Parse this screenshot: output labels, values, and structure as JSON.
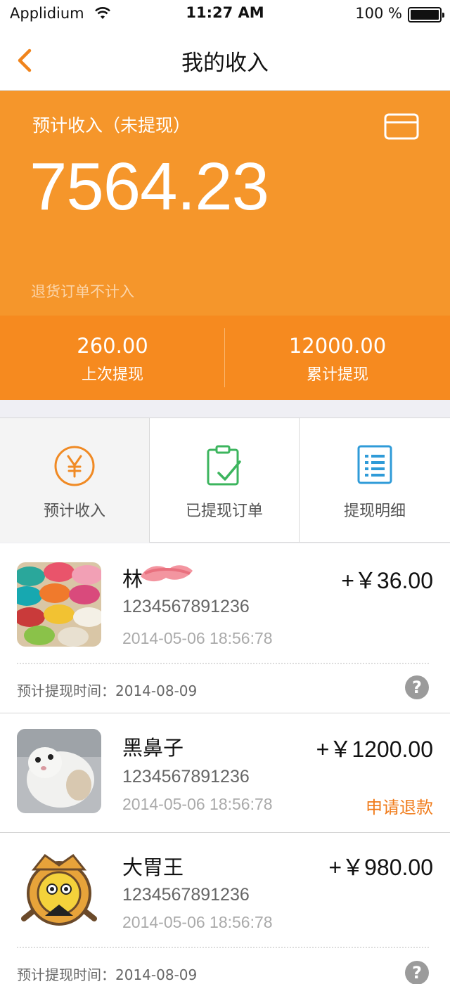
{
  "status_bar": {
    "carrier": "Applidium",
    "time": "11:27 AM",
    "battery": "100 %"
  },
  "nav": {
    "title": "我的收入",
    "back_icon": "chevron-left-icon"
  },
  "summary": {
    "label": "预计收入（未提现）",
    "amount": "7564.23",
    "note": "退货订单不计入",
    "card_icon": "credit-card-icon"
  },
  "stats": [
    {
      "value": "260.00",
      "label": "上次提现"
    },
    {
      "value": "12000.00",
      "label": "累计提现"
    }
  ],
  "tabs": [
    {
      "label": "预计收入",
      "icon": "yen-circle-icon",
      "color": "#f08a24"
    },
    {
      "label": "已提现订单",
      "icon": "clipboard-check-icon",
      "color": "#3cb55e"
    },
    {
      "label": "提现明细",
      "icon": "list-icon",
      "color": "#2f9bd8"
    }
  ],
  "orders": [
    {
      "name": "林",
      "order_no": "1234567891236",
      "datetime": "2014-05-06  18:56:78",
      "price": "+￥36.00",
      "eta_label": "预计提现时间：",
      "eta_date": "2014-08-09",
      "thumb": "colorful-cups-thumbnail"
    },
    {
      "name": "黑鼻子",
      "order_no": "1234567891236",
      "datetime": "2014-05-06  18:56:78",
      "price": "+￥1200.00",
      "refund": "申请退款",
      "thumb": "hamster-thumbnail"
    },
    {
      "name": "大胃王",
      "order_no": "1234567891236",
      "datetime": "2014-05-06  18:56:78",
      "price": "+￥980.00",
      "eta_label": "预计提现时间：",
      "eta_date": "2014-08-09",
      "thumb": "pirate-emblem-thumbnail"
    }
  ],
  "colors": {
    "brand_orange": "#f5962b",
    "stats_orange": "#f68a1f",
    "refund_orange": "#f07b1a"
  }
}
